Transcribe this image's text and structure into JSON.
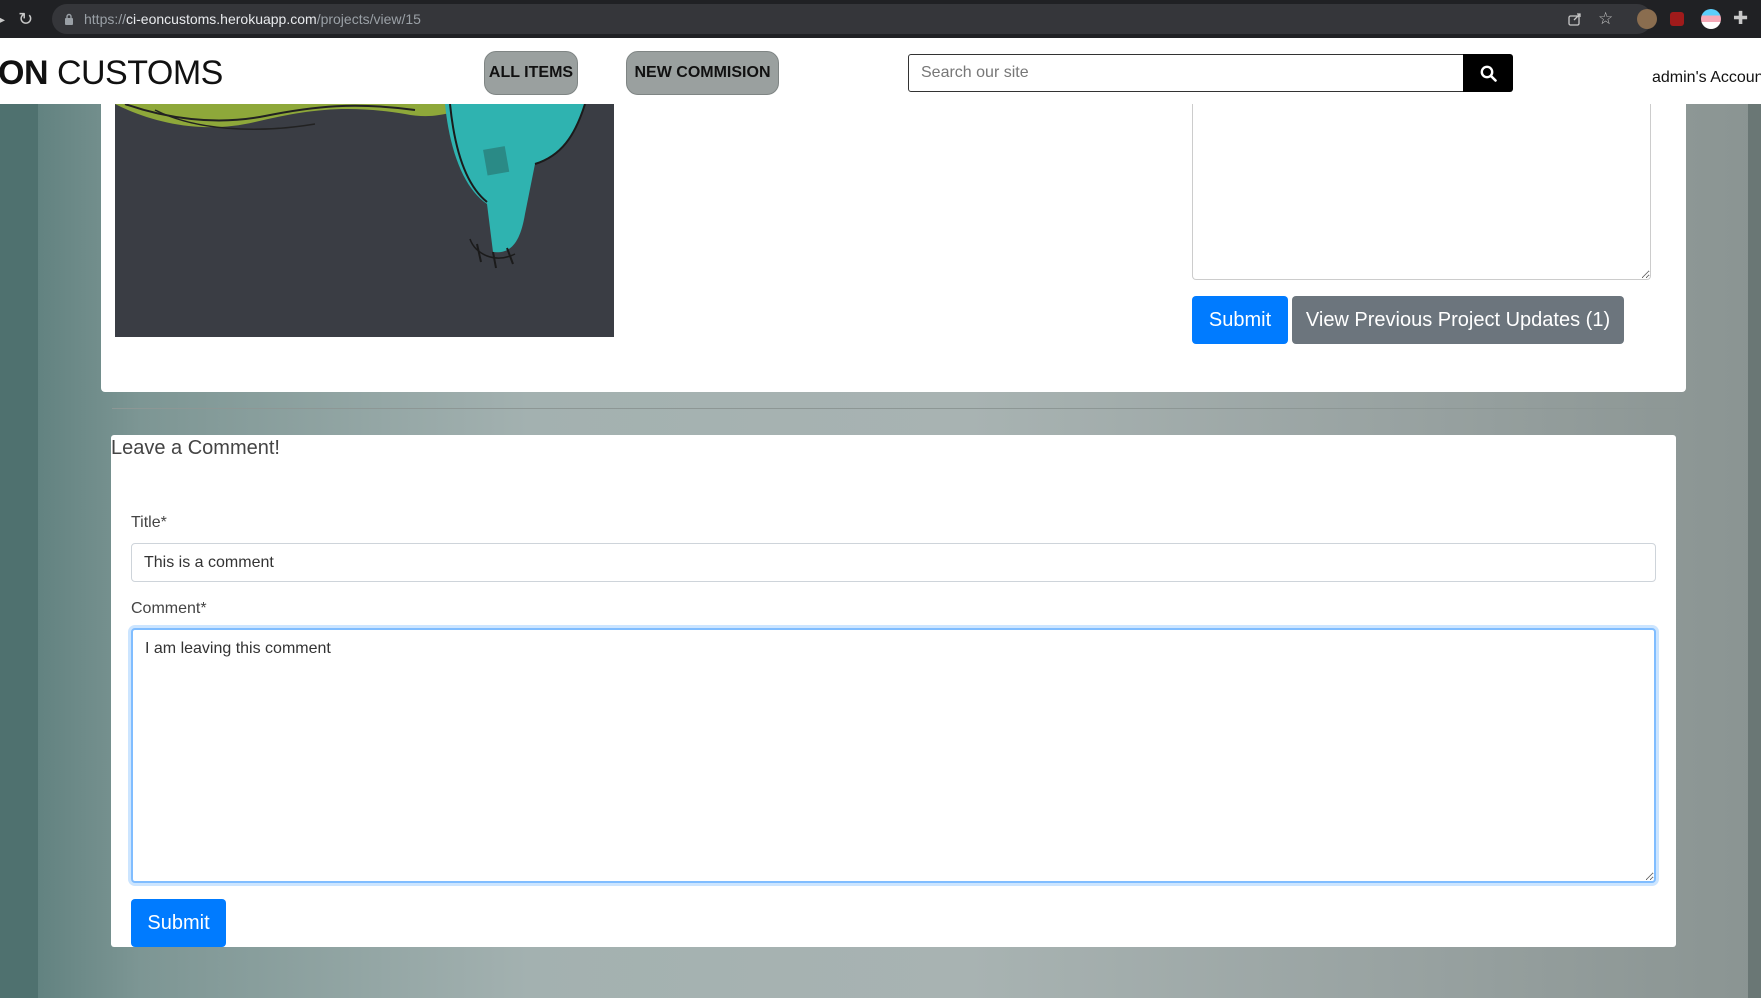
{
  "browser": {
    "url_scheme": "https://",
    "url_host": "ci-eoncustoms.herokuapp.com",
    "url_path": "/projects/view/15"
  },
  "header": {
    "logo_bold": "ON",
    "logo_rest": " CUSTOMS",
    "nav": {
      "all_items": "ALL ITEMS",
      "new_commission": "NEW COMMISION"
    },
    "search": {
      "placeholder": "Search our site",
      "value": ""
    },
    "account_label": "admin's Accoun"
  },
  "project_update": {
    "submit_label": "Submit",
    "view_previous_label": "View Previous Project Updates (1)"
  },
  "comment_form": {
    "heading": "Leave a Comment!",
    "title_label": "Title*",
    "title_value": "This is a comment",
    "comment_label": "Comment*",
    "comment_value": "I am leaving this comment",
    "submit_label": "Submit"
  },
  "colors": {
    "primary": "#007bff",
    "secondary": "#6c757d",
    "nav_pill": "#9aa09f",
    "search_button": "#000000"
  },
  "icons": [
    "back-icon",
    "reload-icon",
    "lock-icon",
    "share-icon",
    "bookmark-star-icon",
    "extension-icons",
    "puzzle-icon",
    "search-icon"
  ]
}
